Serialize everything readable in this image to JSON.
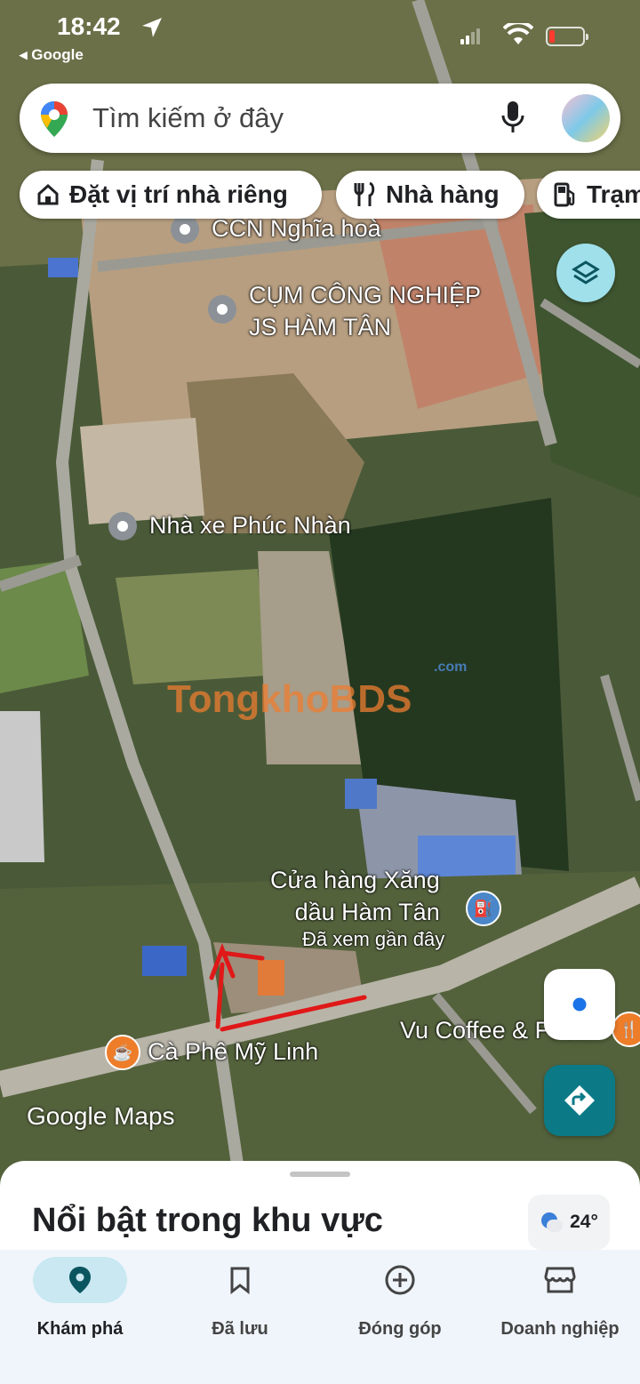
{
  "status_bar": {
    "time": "18:42",
    "back_app": "◂ Google"
  },
  "search": {
    "placeholder": "Tìm kiếm ở đây"
  },
  "chips": [
    {
      "label": "Đặt vị trí nhà riêng",
      "icon": "home-icon"
    },
    {
      "label": "Nhà hàng",
      "icon": "restaurant-icon"
    },
    {
      "label": "Trạm xăng",
      "icon": "gas-station-icon"
    }
  ],
  "map": {
    "places": [
      {
        "name": "CCN Nghĩa hoà"
      },
      {
        "name": "CỤM CÔNG NGHIỆP\nJS HÀM TÂN"
      },
      {
        "name": "Nhà xe Phúc Nhàn"
      },
      {
        "name": "Cửa hàng Xăng\ndầu Hàm Tân",
        "note": "Đã xem gần đây"
      },
      {
        "name": "Cà Phê Mỹ Linh"
      },
      {
        "name": "Vu Coffee & Food"
      }
    ],
    "watermark": "TongkhoBDS",
    "watermark_suffix": ".com",
    "attribution": "Google Maps"
  },
  "sheet": {
    "title": "Nổi bật trong khu vực",
    "weather": "24°"
  },
  "nav": [
    {
      "label": "Khám phá",
      "active": true
    },
    {
      "label": "Đã lưu"
    },
    {
      "label": "Đóng góp"
    },
    {
      "label": "Doanh nghiệp"
    }
  ],
  "colors": {
    "accent": "#0b7a86",
    "nav_active_bg": "#c9e8f2",
    "battery_low": "#ff3b30"
  }
}
